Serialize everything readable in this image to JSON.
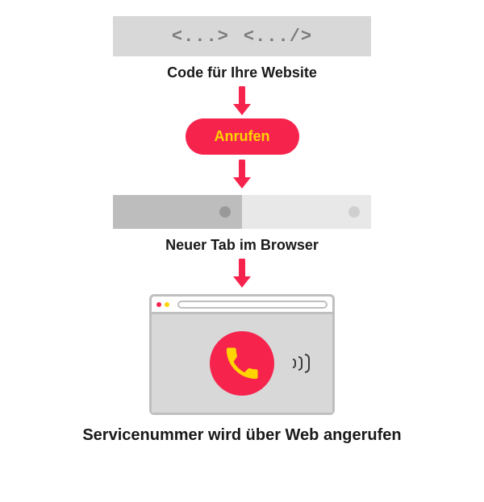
{
  "colors": {
    "accent": "#f6234d",
    "accent_text": "#ffd400",
    "grey_dark": "#bdbdbd",
    "grey_mid": "#d8d8d8",
    "grey_light": "#e8e8e8"
  },
  "step1": {
    "code_fragments": [
      "<...>",
      "<.../>"
    ],
    "caption": "Code für Ihre Website"
  },
  "step2": {
    "button_label": "Anrufen"
  },
  "step3": {
    "caption": "Neuer Tab im Browser"
  },
  "step4": {
    "caption": "Servicenummer wird über Web angerufen"
  },
  "icons": {
    "arrow_down": "arrow-down-icon",
    "phone": "phone-icon",
    "sound_waves": "sound-waves-icon"
  }
}
